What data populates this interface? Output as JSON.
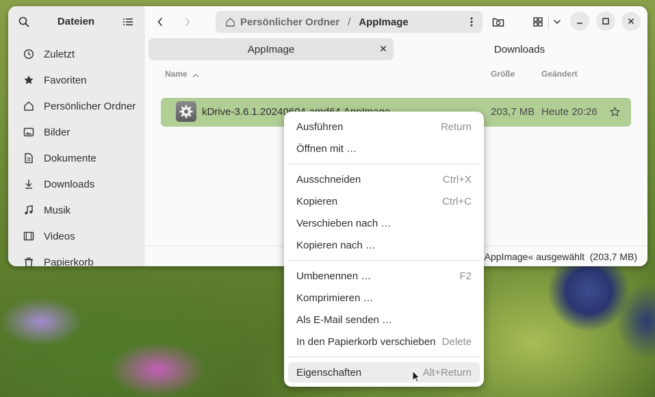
{
  "sidebar": {
    "title": "Dateien",
    "items": [
      {
        "label": "Zuletzt",
        "icon": "clock-icon"
      },
      {
        "label": "Favoriten",
        "icon": "star-icon"
      },
      {
        "label": "Persönlicher Ordner",
        "icon": "home-icon"
      },
      {
        "label": "Bilder",
        "icon": "image-icon"
      },
      {
        "label": "Dokumente",
        "icon": "document-icon"
      },
      {
        "label": "Downloads",
        "icon": "download-icon"
      },
      {
        "label": "Musik",
        "icon": "music-icon"
      },
      {
        "label": "Videos",
        "icon": "video-icon"
      },
      {
        "label": "Papierkorb",
        "icon": "trash-icon"
      }
    ]
  },
  "header": {
    "path": [
      "Persönlicher Ordner",
      "AppImage"
    ],
    "separator": "/"
  },
  "tabs": [
    {
      "label": "AppImage",
      "active": true
    },
    {
      "label": "Downloads",
      "active": false
    }
  ],
  "columns": {
    "name": "Name",
    "size": "Größe",
    "modified": "Geändert"
  },
  "file": {
    "name": "kDrive-3.6.1.20240604-amd64.AppImage",
    "size": "203,7 MB",
    "modified": "Heute 20:26"
  },
  "status": {
    "text": "AppImage« ausgewählt  (203,7 MB)"
  },
  "context_menu": {
    "groups": [
      [
        {
          "label": "Ausführen",
          "shortcut": "Return"
        },
        {
          "label": "Öffnen mit …",
          "shortcut": ""
        }
      ],
      [
        {
          "label": "Ausschneiden",
          "shortcut": "Ctrl+X"
        },
        {
          "label": "Kopieren",
          "shortcut": "Ctrl+C"
        },
        {
          "label": "Verschieben nach …",
          "shortcut": ""
        },
        {
          "label": "Kopieren nach …",
          "shortcut": ""
        }
      ],
      [
        {
          "label": "Umbenennen …",
          "shortcut": "F2"
        },
        {
          "label": "Komprimieren …",
          "shortcut": ""
        },
        {
          "label": "Als E-Mail senden …",
          "shortcut": ""
        },
        {
          "label": "In den Papierkorb verschieben",
          "shortcut": "Delete"
        }
      ],
      [
        {
          "label": "Eigenschaften",
          "shortcut": "Alt+Return"
        }
      ]
    ]
  },
  "colors": {
    "selection": "#b1ce95",
    "menu_hover": "#ececec",
    "window_bg": "#fafafa",
    "sidebar_bg": "#ebebeb"
  }
}
